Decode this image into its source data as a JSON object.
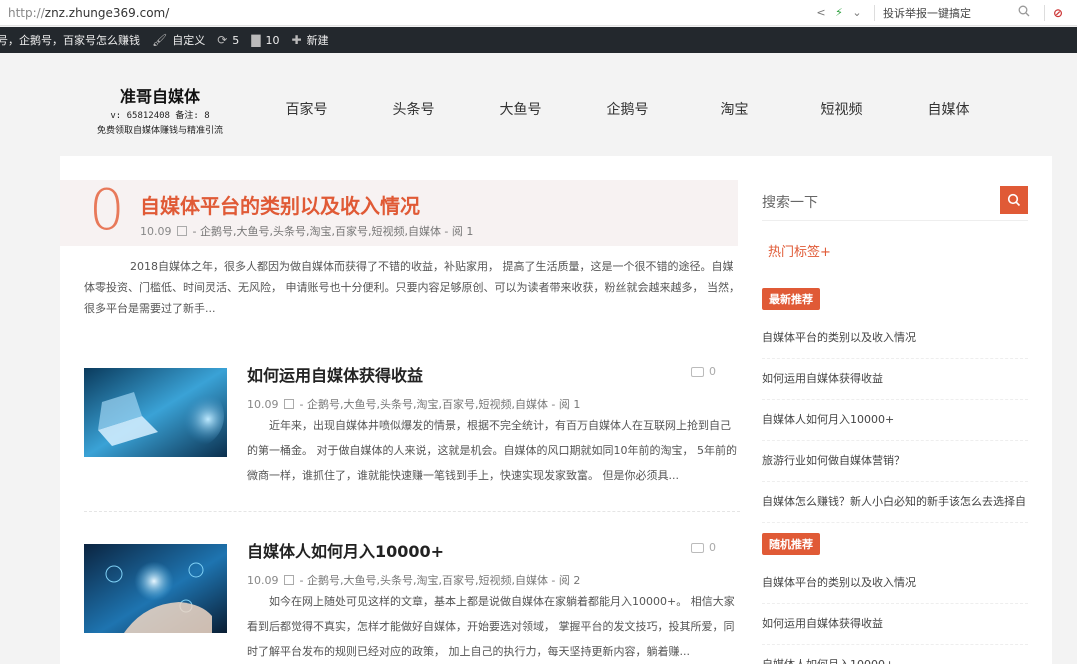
{
  "browser": {
    "url_prefix": "http://",
    "url_host": "znz.zhunge369.com/",
    "report_label": "投诉举报一键搞定"
  },
  "admin_bar": {
    "site_link": "号，企鹅号，百家号怎么赚钱",
    "customize": "自定义",
    "updates": "5",
    "comments": "10",
    "new": "新建"
  },
  "site": {
    "logo_title": "准哥自媒体",
    "logo_line1": "v: 65812408 备注: 8",
    "logo_line2": "免费领取自媒体赚钱与精准引流",
    "nav": [
      "百家号",
      "头条号",
      "大鱼号",
      "企鹅号",
      "淘宝",
      "短视频",
      "自媒体"
    ]
  },
  "featured": {
    "number": "0",
    "title": "自媒体平台的类别以及收入情况",
    "date": "10.09",
    "tags": " - 企鹅号,大鱼号,头条号,淘宝,百家号,短视频,自媒体 - 阅 1",
    "excerpt": "2018自媒体之年，很多人都因为做自媒体而获得了不错的收益，补贴家用， 提高了生活质量，这是一个很不错的途径。自媒体零投资、门槛低、时间灵活、无风险， 申请账号也十分便利。只要内容足够原创、可以为读者带来收获，粉丝就会越来越多， 当然，很多平台是需要过了新手..."
  },
  "posts": [
    {
      "title": "如何运用自媒体获得收益",
      "comments": "0",
      "date": "10.09",
      "tags": " - 企鹅号,大鱼号,头条号,淘宝,百家号,短视频,自媒体 - 阅 1",
      "excerpt": "近年来，出现自媒体井喷似爆发的情景，根据不完全统计，有百万自媒体人在互联网上抢到自己的第一桶金。 对于做自媒体的人来说，这就是机会。自媒体的风口期就如同10年前的淘宝， 5年前的微商一样，谁抓住了，谁就能快速赚一笔钱到手上，快速实现发家致富。 但是你必须具..."
    },
    {
      "title": "自媒体人如何月入10000+",
      "comments": "0",
      "date": "10.09",
      "tags": " - 企鹅号,大鱼号,头条号,淘宝,百家号,短视频,自媒体 - 阅 2",
      "excerpt": "如今在网上随处可见这样的文章，基本上都是说做自媒体在家躺着都能月入10000+。 相信大家看到后都觉得不真实，怎样才能做好自媒体，开始要选对领域， 掌握平台的发文技巧，投其所爱，同时了解平台发布的规则已经对应的政策， 加上自己的执行力，每天坚持更新内容，躺着赚..."
    }
  ],
  "sidebar": {
    "search_placeholder": "搜索一下",
    "hot_tags": "热门标签+",
    "latest_label": "最新推荐",
    "latest": [
      "自媒体平台的类别以及收入情况",
      "如何运用自媒体获得收益",
      "自媒体人如何月入10000+",
      "旅游行业如何做自媒体营销？",
      "自媒体怎么赚钱？新人小白必知的新手该怎么去选择自"
    ],
    "random_label": "随机推荐",
    "random": [
      "自媒体平台的类别以及收入情况",
      "如何运用自媒体获得收益",
      "自媒体人如何月入10000+"
    ]
  },
  "colors": {
    "accent": "#e05a36",
    "admin_bar": "#23282d"
  }
}
